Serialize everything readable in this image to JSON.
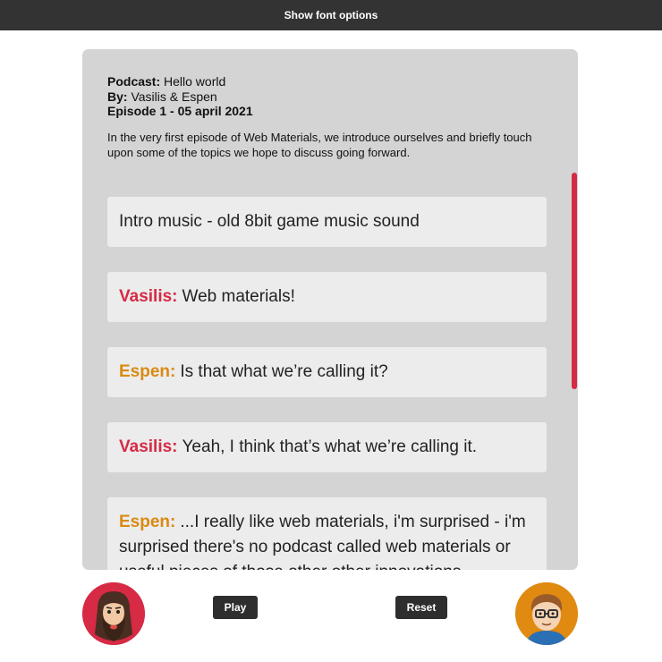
{
  "topbar": {
    "font_options_label": "Show font options"
  },
  "episode": {
    "podcast_label": "Podcast:",
    "podcast_name": "Hello world",
    "by_label": "By:",
    "by_names": "Vasilis & Espen",
    "episode_line": "Episode 1 - 05 april 2021",
    "description": "In the very first episode of Web Materials, we introduce ourselves and briefly touch upon some of the topics we hope to discuss going forward."
  },
  "transcript": {
    "messages": [
      {
        "speaker": "",
        "text": "Intro music - old 8bit game music sound"
      },
      {
        "speaker": "Vasilis:",
        "text": "Web materials!"
      },
      {
        "speaker": "Espen:",
        "text": "Is that what we’re calling it?"
      },
      {
        "speaker": "Vasilis:",
        "text": "Yeah, I think that’s what we’re calling it."
      },
      {
        "speaker": "Espen:",
        "text": "...I really like web materials, i'm surprised - i'm surprised there's no podcast called web materials or useful pieces of those other other innovations"
      }
    ]
  },
  "controls": {
    "play_label": "Play",
    "reset_label": "Reset"
  },
  "avatars": {
    "left": "vasilis-avatar",
    "right": "espen-avatar"
  },
  "colors": {
    "accent_red": "#d62a45",
    "accent_orange": "#d98a12",
    "bar": "#333333",
    "panel": "#d4d4d4"
  }
}
